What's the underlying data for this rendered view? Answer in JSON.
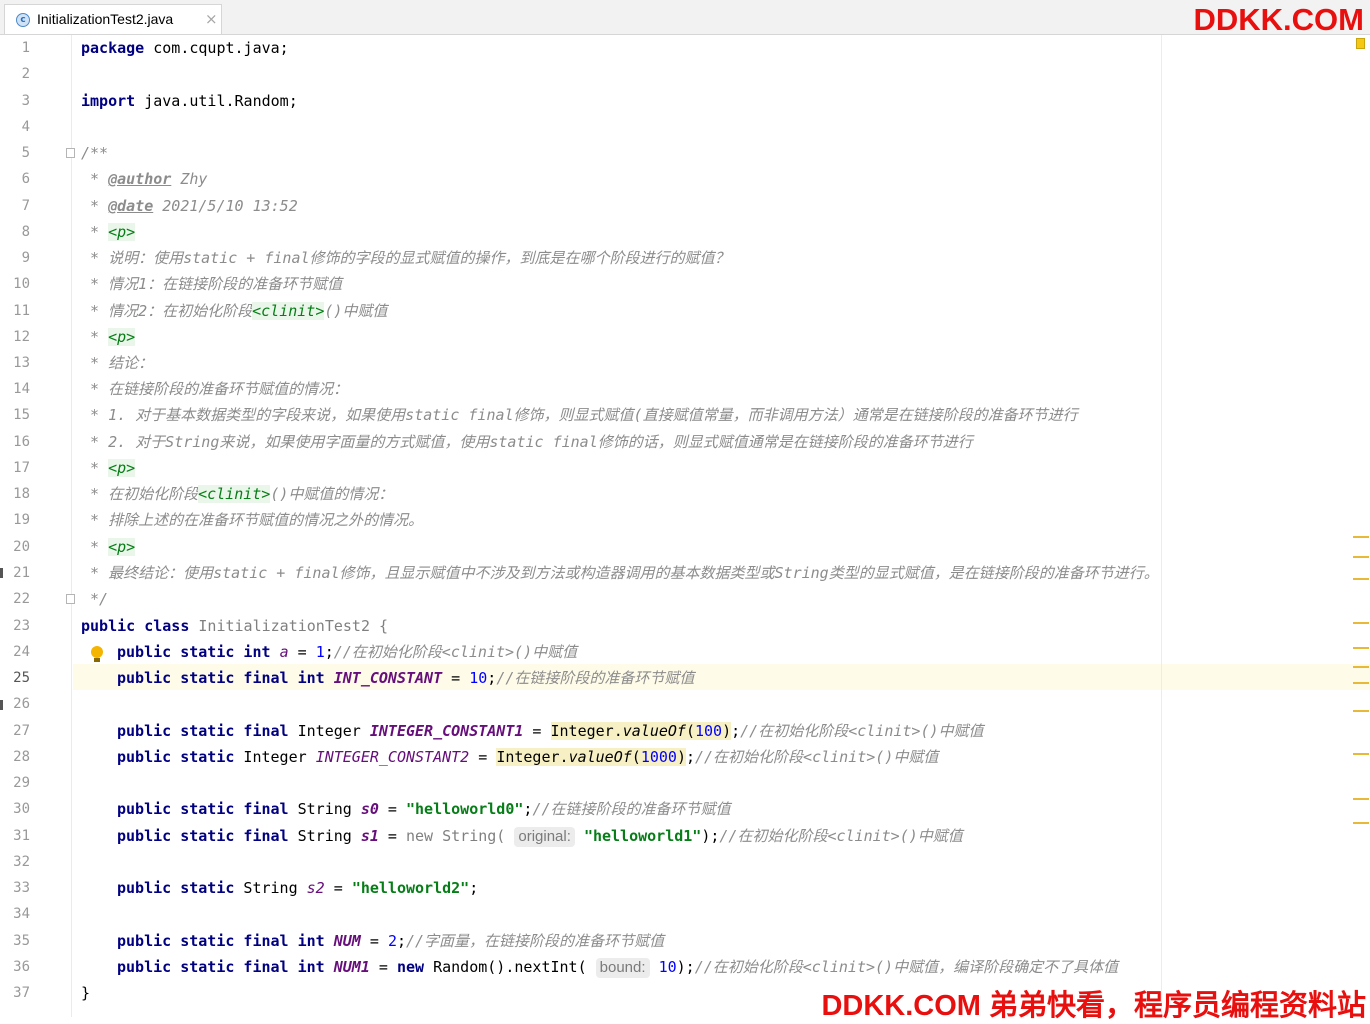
{
  "tab": {
    "icon": "class-icon",
    "icon_glyph": "c",
    "label": "InitializationTest2.java",
    "close_glyph": "×"
  },
  "watermark": {
    "top": "DDKK.COM",
    "bottom": "DDKK.COM 弟弟快看，程序员编程资料站"
  },
  "line_numbers": [
    "1",
    "2",
    "3",
    "4",
    "5",
    "6",
    "7",
    "8",
    "9",
    "10",
    "11",
    "12",
    "13",
    "14",
    "15",
    "16",
    "17",
    "18",
    "19",
    "20",
    "21",
    "22",
    "23",
    "24",
    "25",
    "26",
    "27",
    "28",
    "29",
    "30",
    "31",
    "32",
    "33",
    "34",
    "35",
    "36",
    "37"
  ],
  "current_line": "25",
  "code": {
    "l1": {
      "kw": "package",
      "rest": " com.cqupt.java;"
    },
    "l3": {
      "kw": "import",
      "rest": " java.util.Random;"
    },
    "l5": "/**",
    "l6": {
      "star": " * ",
      "tag": "@author",
      "rest": " Zhy"
    },
    "l7": {
      "star": " * ",
      "tag": "@date",
      "rest": " 2021/5/10 13:52"
    },
    "l8": {
      "star": " * ",
      "p": "<p>"
    },
    "l9": " * 说明：使用static + final修饰的字段的显式赋值的操作，到底是在哪个阶段进行的赋值？",
    "l10": " * 情况1：在链接阶段的准备环节赋值",
    "l11": {
      "pre": " * 情况2：在初始化阶段",
      "clinit": "<clinit>",
      "post": "()中赋值"
    },
    "l12": {
      "star": " * ",
      "p": "<p>"
    },
    "l13": " * 结论：",
    "l14": " * 在链接阶段的准备环节赋值的情况：",
    "l15": " * 1. 对于基本数据类型的字段来说，如果使用static final修饰，则显式赋值(直接赋值常量，而非调用方法）通常是在链接阶段的准备环节进行",
    "l16": " * 2. 对于String来说，如果使用字面量的方式赋值，使用static final修饰的话，则显式赋值通常是在链接阶段的准备环节进行",
    "l17": {
      "star": " * ",
      "p": "<p>"
    },
    "l18": {
      "pre": " * 在初始化阶段",
      "clinit": "<clinit>",
      "post": "()中赋值的情况："
    },
    "l19": " * 排除上述的在准备环节赋值的情况之外的情况。",
    "l20": {
      "star": " * ",
      "p": "<p>"
    },
    "l21": " * 最终结论：使用static + final修饰，且显示赋值中不涉及到方法或构造器调用的基本数据类型或String类型的显式赋值，是在链接阶段的准备环节进行。",
    "l22": " */",
    "l23": {
      "kw": "public class",
      "rest": " InitializationTest2 {"
    },
    "l24": {
      "kw": "public static int",
      "field": "a",
      "eq": " = ",
      "num": "1",
      "semi": ";",
      "cm": "//在初始化阶段<clinit>()中赋值"
    },
    "l25": {
      "kw": "public static final int",
      "field": "INT_CONSTANT",
      "eq": " = ",
      "num": "10",
      "semi": ";",
      "cm": "//在链接阶段的准备环节赋值"
    },
    "l27": {
      "kw": "public static final",
      "type": " Integer ",
      "field": "INTEGER_CONSTANT1",
      "eq": " = ",
      "call_a": "Integer.",
      "call_m": "valueOf",
      "call_open": "(",
      "num": "100",
      "call_close": ")",
      "semi": ";",
      "cm": "//在初始化阶段<clinit>()中赋值"
    },
    "l28": {
      "kw": "public static",
      "type": " Integer ",
      "field": "INTEGER_CONSTANT2",
      "eq": " = ",
      "call_a": "Integer.",
      "call_m": "valueOf",
      "call_open": "(",
      "num": "1000",
      "call_close": ")",
      "semi": ";",
      "cm": "//在初始化阶段<clinit>()中赋值"
    },
    "l30": {
      "kw": "public static final",
      "type": " String ",
      "field": "s0",
      "eq": " = ",
      "str": "\"helloworld0\"",
      "semi": ";",
      "cm": "//在链接阶段的准备环节赋值"
    },
    "l31": {
      "kw": "public static final",
      "type": " String ",
      "field": "s1",
      "eq": " = ",
      "new": "new",
      "ctor": " String( ",
      "hint": "original:",
      "str": "\"helloworld1\"",
      "semi": ");",
      "cm": "//在初始化阶段<clinit>()中赋值"
    },
    "l33": {
      "kw": "public static",
      "type": " String ",
      "field": "s2",
      "eq": " = ",
      "str": "\"helloworld2\"",
      "semi": ";"
    },
    "l35": {
      "kw": "public static final int",
      "field": "NUM",
      "eq": " = ",
      "num": "2",
      "semi": ";",
      "cm": "//字面量，在链接阶段的准备环节赋值"
    },
    "l36": {
      "kw": "public static final int",
      "field": "NUM1",
      "eq": " = ",
      "new": "new",
      "ctor": " Random().nextInt( ",
      "hint": "bound:",
      "num": "10",
      "semi": ");",
      "cm": "//在初始化阶段<clinit>()中赋值，编译阶段确定不了具体值"
    },
    "l37": "}"
  }
}
